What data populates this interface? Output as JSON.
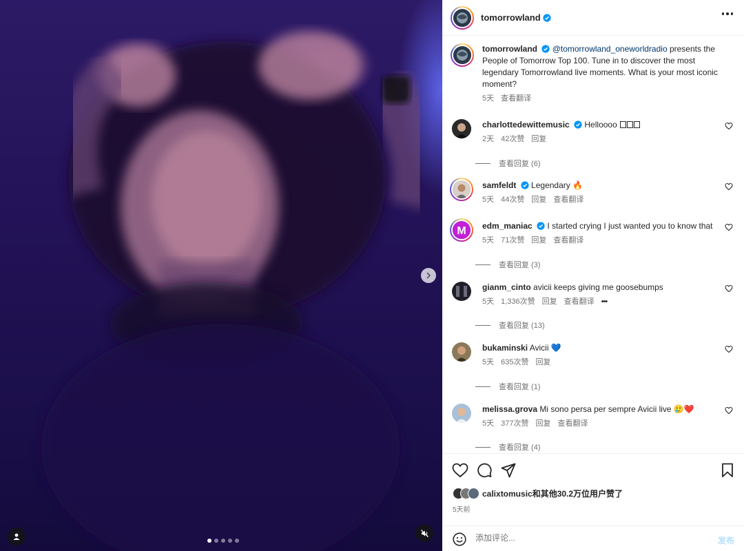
{
  "account": {
    "username": "tomorrowland",
    "verified": true
  },
  "header": {
    "more_label": ""
  },
  "media": {
    "slide_count": 5,
    "active_slide": 0
  },
  "caption": {
    "username": "tomorrowland",
    "mention": "@tomorrowland_oneworldradio",
    "text": " presents the People of Tomorrow Top 100. Tune in to discover the most legendary Tomorrowland live moments. What is your most iconic moment?",
    "time": "5天",
    "translate": "查看翻译"
  },
  "comments": [
    {
      "username": "charlottedewittemusic",
      "verified": true,
      "text": "Helloooo ",
      "time": "2天",
      "likes": "42次赞",
      "reply": "回复",
      "translate": "",
      "view_replies": "查看回复 (6)"
    },
    {
      "username": "samfeldt",
      "verified": true,
      "text": "Legendary ",
      "emoji": "🔥",
      "time": "5天",
      "likes": "44次赞",
      "reply": "回复",
      "translate": "查看翻译",
      "view_replies": ""
    },
    {
      "username": "edm_maniac",
      "verified": true,
      "text": "I started crying I just wanted you to know that",
      "time": "5天",
      "likes": "71次赞",
      "reply": "回复",
      "translate": "查看翻译",
      "view_replies": "查看回复 (3)"
    },
    {
      "username": "gianm_cinto",
      "verified": false,
      "text": "avicii keeps giving me goosebumps",
      "time": "5天",
      "likes": "1,336次赞",
      "reply": "回复",
      "translate": "查看翻译",
      "more": "•••",
      "view_replies": "查看回复 (13)"
    },
    {
      "username": "bukaminski",
      "verified": false,
      "text": "Avicii ",
      "emoji": "💙",
      "time": "5天",
      "likes": "635次赞",
      "reply": "回复",
      "translate": "",
      "view_replies": "查看回复 (1)"
    },
    {
      "username": "melissa.grova",
      "verified": false,
      "text": "Mi sono persa per sempre Avicii live ",
      "emoji": "🥲❤️",
      "time": "5天",
      "likes": "377次赞",
      "reply": "回复",
      "translate": "查看翻译",
      "view_replies": "查看回复 (4)"
    }
  ],
  "likes_summary": {
    "text": "calixtomusic和其他30.2万位用户赞了"
  },
  "posted": {
    "time": "5天前"
  },
  "comment_box": {
    "placeholder": "添加评论...",
    "post_label": "发布"
  },
  "colors": {
    "accent": "#0095f6",
    "verified": "#0095f6",
    "heart_red": "#ed4956"
  }
}
